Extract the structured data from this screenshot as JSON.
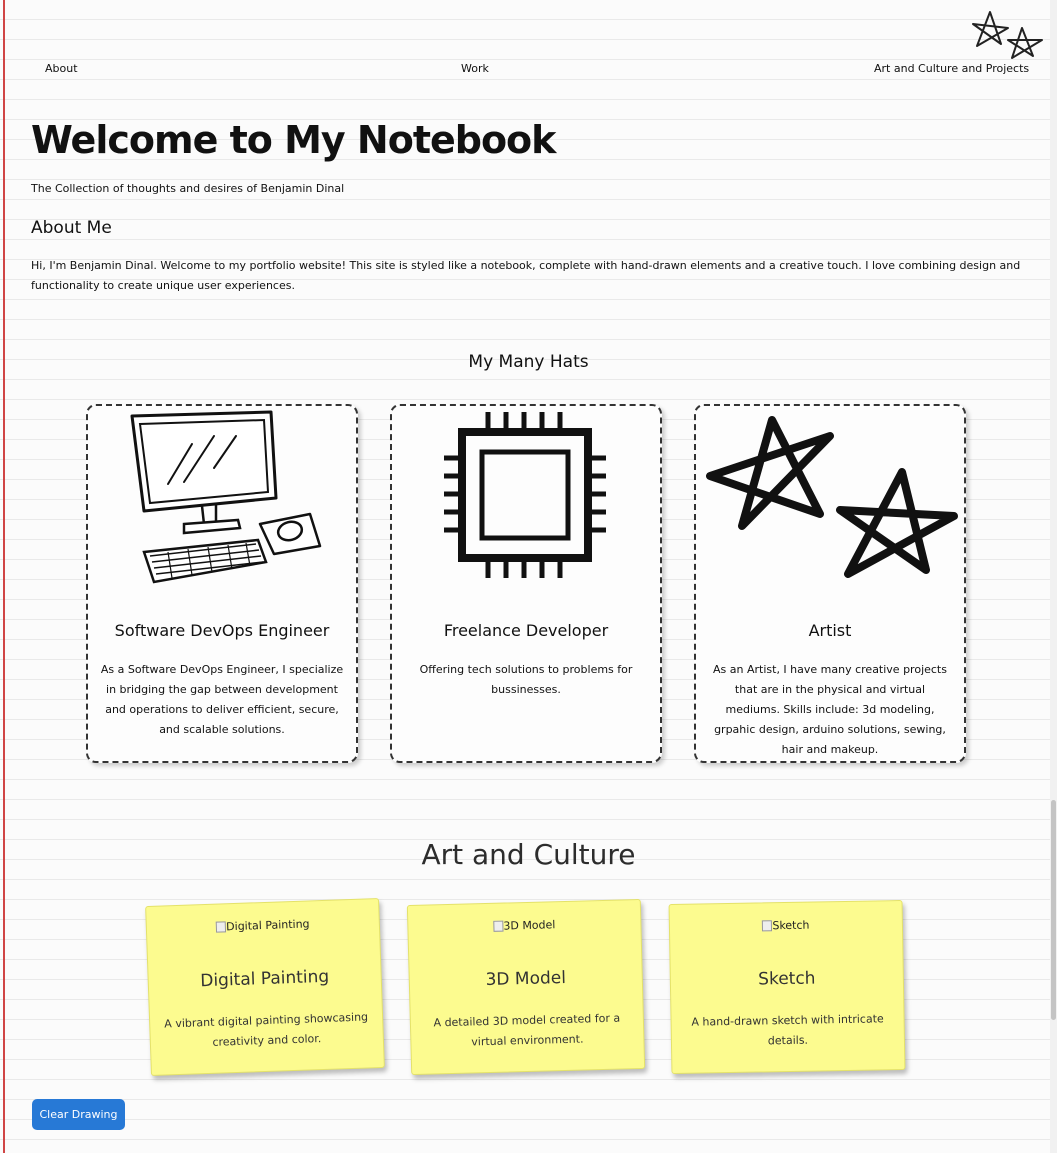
{
  "nav": {
    "items": [
      {
        "label": "About"
      },
      {
        "label": "Work"
      },
      {
        "label": "Art and Culture and Projects"
      }
    ]
  },
  "header": {
    "title": "Welcome to My Notebook",
    "subtitle": "The Collection of thoughts and desires of Benjamin Dinal"
  },
  "about": {
    "heading": "About Me",
    "text": "Hi, I'm Benjamin Dinal. Welcome to my portfolio website! This site is styled like a notebook, complete with hand-drawn elements and a creative touch. I love combining design and functionality to create unique user experiences."
  },
  "hats": {
    "heading": "My Many Hats",
    "cards": [
      {
        "icon": "computer-icon",
        "title": "Software DevOps Engineer",
        "description": "As a Software DevOps Engineer, I specialize in bridging the gap between development and operations to deliver efficient, secure, and scalable solutions."
      },
      {
        "icon": "chip-icon",
        "title": "Freelance Developer",
        "description": "Offering tech solutions to problems for bussinesses."
      },
      {
        "icon": "stars-icon",
        "title": "Artist",
        "description": "As an Artist, I have many creative projects that are in the physical and virtual mediums. Skills include: 3d modeling, grpahic design, arduino solutions, sewing, hair and makeup."
      }
    ]
  },
  "art": {
    "heading": "Art and Culture",
    "cards": [
      {
        "img_alt": "Digital Painting",
        "title": "Digital Painting",
        "description": "A vibrant digital painting showcasing creativity and color."
      },
      {
        "img_alt": "3D Model",
        "title": "3D Model",
        "description": "A detailed 3D model created for a virtual environment."
      },
      {
        "img_alt": "Sketch",
        "title": "Sketch",
        "description": "A hand-drawn sketch with intricate details."
      }
    ]
  },
  "actions": {
    "clear_label": "Clear Drawing"
  },
  "colors": {
    "margin_line": "#d04545",
    "sticky_note": "#fcfb8f",
    "button": "#2779d6"
  }
}
